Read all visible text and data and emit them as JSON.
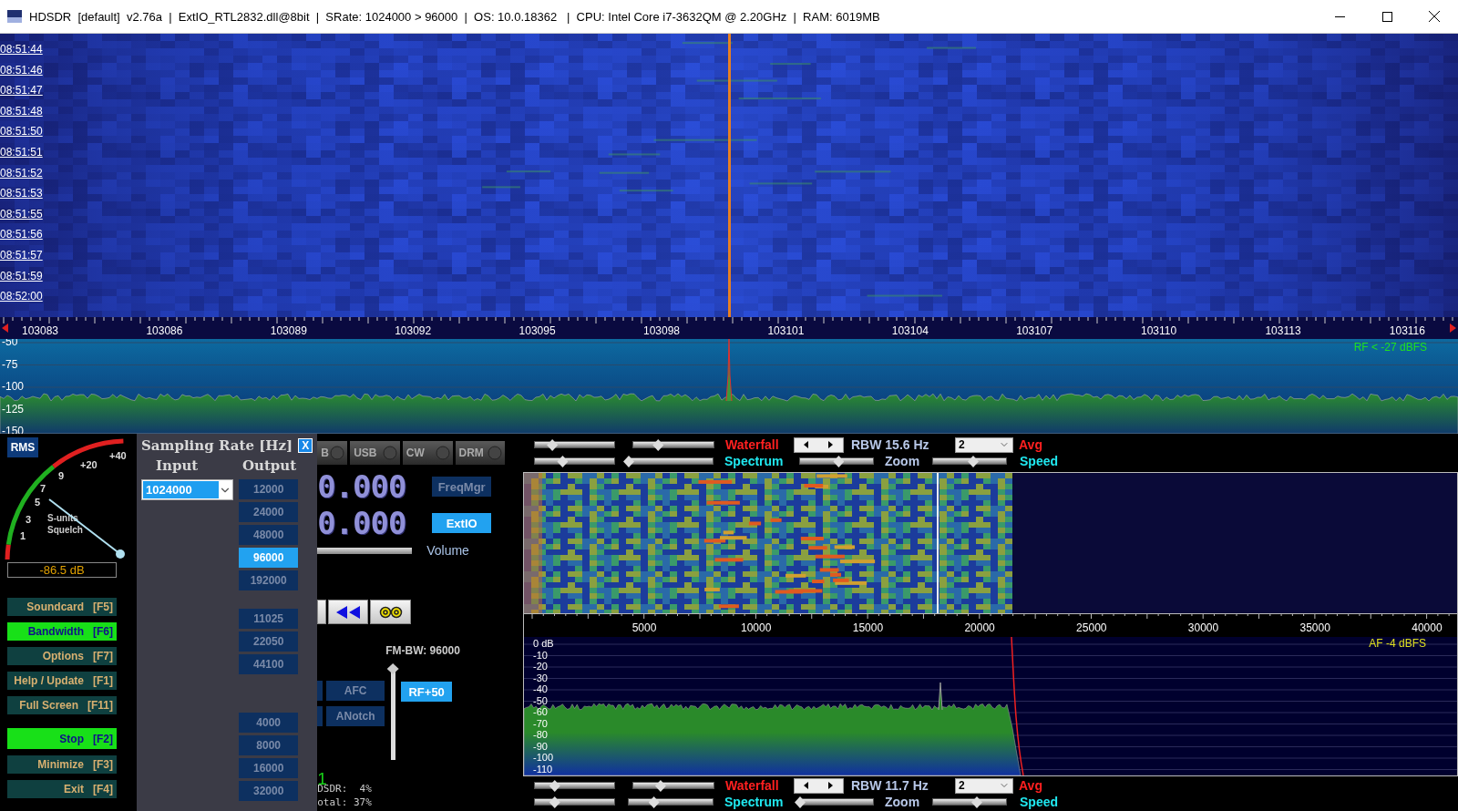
{
  "window": {
    "title": "HDSDR  [default]  v2.76a  |  ExtIO_RTL2832.dll@8bit  |  SRate: 1024000 > 96000  |  OS: 10.0.18362   |  CPU: Intel Core i7-3632QM @ 2.20GHz  |  RAM: 6019MB"
  },
  "waterfall": {
    "times": [
      "08:51:44",
      "08:51:46",
      "08:51:47",
      "08:51:48",
      "08:51:50",
      "08:51:51",
      "08:51:52",
      "08:51:53",
      "08:51:55",
      "08:51:56",
      "08:51:57",
      "08:51:59",
      "08:52:00"
    ]
  },
  "frequency_axis": {
    "labels": [
      "103083",
      "103086",
      "103089",
      "103092",
      "103095",
      "103098",
      "103101",
      "103104",
      "103107",
      "103110",
      "103113",
      "103116"
    ]
  },
  "rf_spectrum": {
    "scale": [
      "-50",
      "-75",
      "-100",
      "-125",
      "-150"
    ],
    "status": "RF < -27 dBFS"
  },
  "smeter": {
    "mode": "RMS",
    "scale": [
      "1",
      "3",
      "5",
      "7",
      "9",
      "+20",
      "+40"
    ],
    "captions": [
      "S-units",
      "Squelch"
    ],
    "reading": "-86.5 dB"
  },
  "function_buttons": [
    {
      "label": "Soundcard",
      "key": "[F5]",
      "on": false,
      "gap": false
    },
    {
      "label": "Bandwidth",
      "key": "[F6]",
      "on": true,
      "gap": false
    },
    {
      "label": "Options",
      "key": "[F7]",
      "on": false,
      "gap": false
    },
    {
      "label": "Help / Update",
      "key": "[F1]",
      "on": false,
      "gap": false
    },
    {
      "label": "Full Screen",
      "key": "[F11]",
      "on": false,
      "gap": false
    },
    {
      "label": "Stop",
      "key": "[F2]",
      "on": true,
      "gap": true
    },
    {
      "label": "Minimize",
      "key": "[F3]",
      "on": false,
      "gap": false
    },
    {
      "label": "Exit",
      "key": "[F4]",
      "on": false,
      "gap": false
    }
  ],
  "sampling_rate": {
    "title": "Sampling Rate [Hz]",
    "close": "X",
    "input_label": "Input",
    "output_label": "Output",
    "input_value": "1024000",
    "output_groups": [
      [
        {
          "label": "12000",
          "selected": false
        },
        {
          "label": "24000",
          "selected": false
        },
        {
          "label": "48000",
          "selected": false
        },
        {
          "label": "96000",
          "selected": true
        },
        {
          "label": "192000",
          "selected": false
        }
      ],
      [
        {
          "label": "11025",
          "selected": false
        },
        {
          "label": "22050",
          "selected": false
        },
        {
          "label": "44100",
          "selected": false
        }
      ],
      [
        {
          "label": "4000",
          "selected": false
        },
        {
          "label": "8000",
          "selected": false
        },
        {
          "label": "16000",
          "selected": false
        },
        {
          "label": "32000",
          "selected": false
        }
      ]
    ]
  },
  "modes": [
    "B",
    "USB",
    "CW",
    "DRM"
  ],
  "frequency_displays": [
    "0.000",
    "0.000"
  ],
  "side_buttons": [
    {
      "label": "FreqMgr",
      "selected": false
    },
    {
      "label": "ExtIO",
      "selected": true
    }
  ],
  "volume": {
    "label": "Volume",
    "level": 1
  },
  "fm_bw": {
    "label": "FM-BW: 96000",
    "level": 1
  },
  "rf_gain": {
    "label": "RF+50",
    "selected": true
  },
  "dsp_buttons": [
    {
      "label": "AFC",
      "selected": false
    },
    {
      "label": "ANotch",
      "selected": false
    }
  ],
  "stats": {
    "counter": "1",
    "lines": [
      "DSDR:  4%",
      "otal: 37%"
    ]
  },
  "control_rows": [
    {
      "waterfall": "Waterfall",
      "rbw": "RBW 15.6 Hz",
      "avg_value": "2",
      "avg": "Avg",
      "spectrum": "Spectrum",
      "zoom": "Zoom",
      "speed": "Speed",
      "sliders": [
        {
          "level": 0.22
        },
        {
          "level": 0.31
        },
        {
          "level": 0.35
        },
        {
          "level": 0.0
        },
        {
          "level": 0.53
        },
        {
          "level": 0.55
        }
      ]
    },
    {
      "waterfall": "Waterfall",
      "rbw": "RBW 11.7 Hz",
      "avg_value": "2",
      "avg": "Avg",
      "spectrum": "Spectrum",
      "zoom": "Zoom",
      "speed": "Speed",
      "sliders": [
        {
          "level": 0.25
        },
        {
          "level": 0.34
        },
        {
          "level": 0.25
        },
        {
          "level": 0.3
        },
        {
          "level": 0.0
        },
        {
          "level": 0.6
        }
      ]
    }
  ],
  "af_axis": {
    "labels": [
      "5000",
      "10000",
      "15000",
      "20000",
      "25000",
      "30000",
      "35000",
      "40000"
    ]
  },
  "af_spectrum": {
    "scale": [
      "0 dB",
      "-10",
      "-20",
      "-30",
      "-40",
      "-50",
      "-60",
      "-70",
      "-80",
      "-90",
      "-100",
      "-110"
    ],
    "status": "AF  -4 dBFS"
  }
}
